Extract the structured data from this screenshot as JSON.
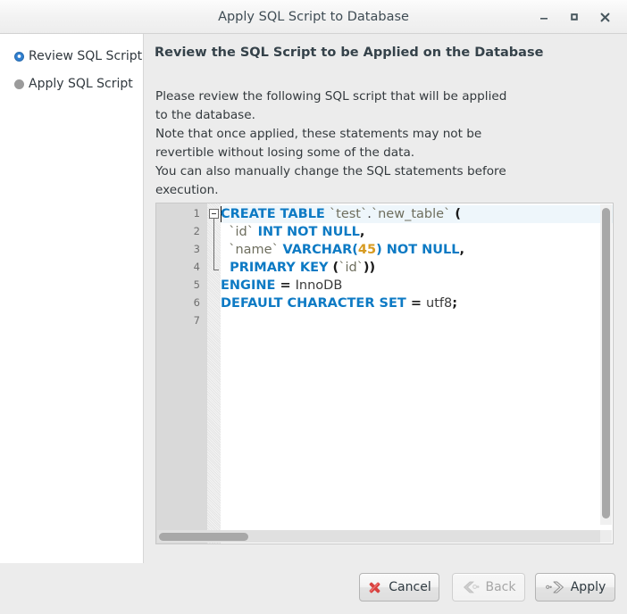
{
  "window": {
    "title": "Apply SQL Script to Database",
    "minimize_label": "Minimize",
    "maximize_label": "Maximize",
    "close_label": "Close"
  },
  "sidebar": {
    "items": [
      {
        "label": "Review SQL Script",
        "state": "active"
      },
      {
        "label": "Apply SQL Script",
        "state": "pending"
      }
    ]
  },
  "main": {
    "page_title": "Review the SQL Script to be Applied on the Database",
    "description_lines": [
      "Please review the following SQL script that will be applied",
      "to the database.",
      "Note that once applied, these statements may not be",
      "revertible without losing some of the data.",
      "You can also manually change the SQL statements before",
      "execution."
    ]
  },
  "editor": {
    "line_numbers": [
      "1",
      "2",
      "3",
      "4",
      "5",
      "6",
      "7"
    ],
    "sql_text": "CREATE TABLE `test`.`new_table` (\n  `id` INT NOT NULL,\n  `name` VARCHAR(45) NOT NULL,\n  PRIMARY KEY (`id`))\nENGINE = InnoDB\nDEFAULT CHARACTER SET = utf8;\n",
    "lines": [
      {
        "n": "1",
        "tokens": [
          {
            "t": "CREATE TABLE ",
            "c": "kw"
          },
          {
            "t": "`test`",
            "c": "ident"
          },
          {
            "t": ".",
            "c": "plain"
          },
          {
            "t": "`new_table`",
            "c": "ident"
          },
          {
            "t": " (",
            "c": "punc"
          }
        ]
      },
      {
        "n": "2",
        "tokens": [
          {
            "t": "  `id` ",
            "c": "ident"
          },
          {
            "t": "INT NOT NULL",
            "c": "kw"
          },
          {
            "t": ",",
            "c": "punc"
          }
        ]
      },
      {
        "n": "3",
        "tokens": [
          {
            "t": "  `name` ",
            "c": "ident"
          },
          {
            "t": "VARCHAR(",
            "c": "kw"
          },
          {
            "t": "45",
            "c": "num"
          },
          {
            "t": ") NOT NULL",
            "c": "kw"
          },
          {
            "t": ",",
            "c": "punc"
          }
        ]
      },
      {
        "n": "4",
        "tokens": [
          {
            "t": "  PRIMARY KEY ",
            "c": "kw"
          },
          {
            "t": "(",
            "c": "punc"
          },
          {
            "t": "`id`",
            "c": "ident"
          },
          {
            "t": "))",
            "c": "punc"
          }
        ]
      },
      {
        "n": "5",
        "tokens": [
          {
            "t": "ENGINE ",
            "c": "kw"
          },
          {
            "t": "= ",
            "c": "punc"
          },
          {
            "t": "InnoDB",
            "c": "plain"
          }
        ]
      },
      {
        "n": "6",
        "tokens": [
          {
            "t": "DEFAULT CHARACTER SET ",
            "c": "kw"
          },
          {
            "t": "= ",
            "c": "punc"
          },
          {
            "t": "utf8",
            "c": "plain"
          },
          {
            "t": ";",
            "c": "punc"
          }
        ]
      },
      {
        "n": "7",
        "tokens": []
      }
    ],
    "fold_marker": "collapse"
  },
  "footer": {
    "cancel_label": "Cancel",
    "back_label": "Back",
    "apply_label": "Apply",
    "back_enabled": false
  },
  "colors": {
    "keyword": "#0d7ac4",
    "identifier": "#6e6e5e",
    "number": "#d79b21",
    "accent_blue": "#2f7fd0",
    "cancel_red": "#cc2a2a",
    "window_bg": "#ececec"
  }
}
